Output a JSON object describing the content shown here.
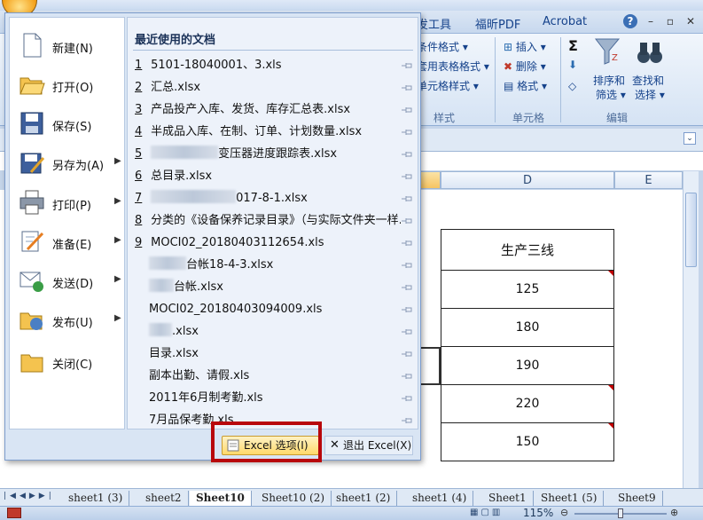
{
  "ribbon": {
    "tabs": [
      "发工具",
      "福昕PDF",
      "Acrobat"
    ],
    "styles_group": {
      "items": [
        "条件格式",
        "套用表格格式",
        "单元格样式"
      ],
      "label": "样式"
    },
    "cells_group": {
      "items": [
        "插入",
        "删除",
        "格式"
      ],
      "label": "单元格"
    },
    "edit_group": {
      "sort_filter": "排序和\n筛选",
      "sort_line1": "排序和",
      "sort_line2": "筛选",
      "find_select_line1": "查找和",
      "find_select_line2": "选择",
      "label": "编辑"
    }
  },
  "sheet": {
    "columns": [
      "D",
      "E"
    ],
    "header_cell": "生产三线",
    "values": [
      "125",
      "180",
      "190",
      "220",
      "150"
    ]
  },
  "office_menu": {
    "left_items": [
      {
        "label": "新建(N)",
        "icon": "new-document-icon",
        "has_submenu": false
      },
      {
        "label": "打开(O)",
        "icon": "open-folder-icon",
        "has_submenu": false
      },
      {
        "label": "保存(S)",
        "icon": "save-disk-icon",
        "has_submenu": false
      },
      {
        "label": "另存为(A)",
        "icon": "save-as-icon",
        "has_submenu": true
      },
      {
        "label": "打印(P)",
        "icon": "printer-icon",
        "has_submenu": true
      },
      {
        "label": "准备(E)",
        "icon": "prepare-icon",
        "has_submenu": true
      },
      {
        "label": "发送(D)",
        "icon": "send-icon",
        "has_submenu": true
      },
      {
        "label": "发布(U)",
        "icon": "publish-icon",
        "has_submenu": true
      },
      {
        "label": "关闭(C)",
        "icon": "close-folder-icon",
        "has_submenu": false
      }
    ],
    "recent_title": "最近使用的文档",
    "recent_docs": [
      {
        "num": "1",
        "name": "5101-18040001、3.xls"
      },
      {
        "num": "2",
        "name": "汇总.xlsx"
      },
      {
        "num": "3",
        "name": "产品投产入库、发货、库存汇总表.xlsx"
      },
      {
        "num": "4",
        "name": "半成品入库、在制、订单、计划数量.xlsx"
      },
      {
        "num": "5",
        "name": "变压器进度跟踪表.xlsx"
      },
      {
        "num": "6",
        "name": "总目录.xlsx"
      },
      {
        "num": "7",
        "name": "017-8-1.xlsx"
      },
      {
        "num": "8",
        "name": "分类的《设备保养记录目录》（与实际文件夹一样..."
      },
      {
        "num": "9",
        "name": "MOCI02_20180403112654.xls"
      },
      {
        "num": "",
        "name": "台帐18-4-3.xlsx"
      },
      {
        "num": "",
        "name": "台帐.xlsx"
      },
      {
        "num": "",
        "name": "MOCI02_20180403094009.xls"
      },
      {
        "num": "",
        "name": ".xlsx"
      },
      {
        "num": "",
        "name": "目录.xlsx"
      },
      {
        "num": "",
        "name": "副本出勤、请假.xls"
      },
      {
        "num": "",
        "name": "2011年6月制考勤.xls"
      },
      {
        "num": "",
        "name": "7月品保考勤.xls"
      }
    ],
    "options_button": "Excel 选项(I)",
    "exit_button": "退出 Excel(X)"
  },
  "sheet_tabs": [
    "sheet1 (3)",
    "sheet2",
    "Sheet10",
    "Sheet10 (2)",
    "sheet1 (2)",
    "sheet1 (4)",
    "Sheet1",
    "Sheet1 (5)",
    "Sheet9"
  ],
  "status": {
    "zoom": "115%"
  },
  "colors": {
    "highlight_border": "#b8070b",
    "menu_bg": "#d9e5f4",
    "ribbon_text": "#15428b"
  }
}
